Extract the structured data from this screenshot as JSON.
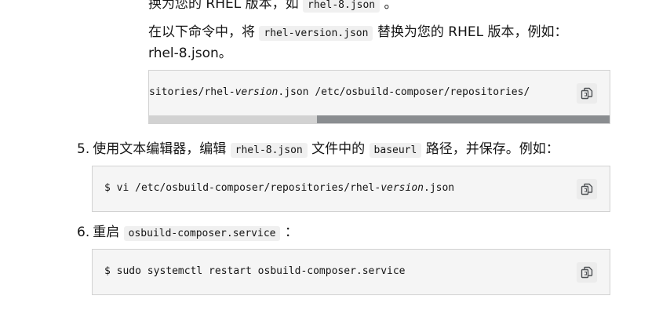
{
  "step4": {
    "line1_text": "换为您的 RHEL 版本，如",
    "line1_code": "rhel-8.json",
    "line1_end": "。",
    "line2_pre": "在以下命令中，将",
    "line2_code": "rhel-version.json",
    "line2_post": "替换为您的 RHEL 版本，例如：",
    "line3": "rhel-8.json。",
    "code": {
      "prefix": "sitories/rhel-",
      "italic": "version",
      "suffix": ".json /etc/osbuild-composer/repositories/"
    }
  },
  "step5": {
    "number": "5.",
    "pre": "使用文本编辑器，编辑",
    "code1": "rhel-8.json",
    "mid": "文件中的",
    "code2": "baseurl",
    "post": "路径，并保存。例如：",
    "cmd": {
      "prefix": "$ vi /etc/osbuild-composer/repositories/rhel-",
      "italic": "version",
      "suffix": ".json"
    }
  },
  "step6": {
    "number": "6.",
    "pre": "重启",
    "code": "osbuild-composer.service",
    "post": "：",
    "cmd": "$ sudo systemctl restart osbuild-composer.service"
  },
  "icons": {
    "copy": "copy-icon"
  }
}
